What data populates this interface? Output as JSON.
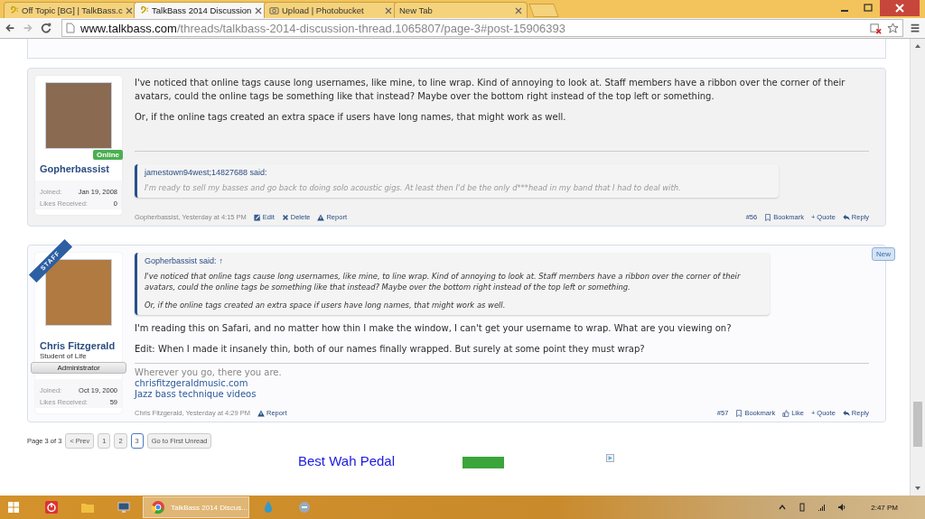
{
  "browser": {
    "tabs": [
      {
        "title": "Off Topic [BG] | TalkBass.c",
        "selected": false,
        "kind": "bass"
      },
      {
        "title": "TalkBass 2014 Discussion",
        "selected": true,
        "kind": "bass"
      },
      {
        "title": "Upload | Photobucket",
        "selected": false,
        "kind": "camera"
      },
      {
        "title": "New Tab",
        "selected": false,
        "kind": "none"
      }
    ],
    "url_host": "www.talkbass.com",
    "url_path": "/threads/talkbass-2014-discussion-thread.1065807/page-3#post-15906393"
  },
  "posts": [
    {
      "author": "Gopherbassist",
      "online": true,
      "online_label": "Online",
      "staff": false,
      "highlighted": true,
      "joined_label": "Joined:",
      "joined": "Jan 19, 2008",
      "likes_label": "Likes Received:",
      "likes": "0",
      "content": [
        {
          "kind": "paragraph",
          "text": "I've noticed that online tags cause long usernames, like mine, to line wrap. Kind of annoying to look at. Staff members have a ribbon over the corner of their avatars, could the online tags be something like that instead? Maybe over the bottom right instead of the top left or something."
        },
        {
          "kind": "paragraph",
          "text": "Or, if the online tags created an extra space if users have long names, that might work as well."
        }
      ],
      "signature": [
        {
          "kind": "quote",
          "author": "jamestown94west;14827688 said:",
          "paragraphs": [
            "I'm ready to sell my basses and go back to doing solo acoustic gigs. At least then I'd be the only d***head in my band that I had to deal with."
          ]
        }
      ],
      "byline": "Gopherbassist, Yesterday at 4:15 PM",
      "left_actions": [
        {
          "kind": "edit",
          "label": "Edit"
        },
        {
          "kind": "delete",
          "label": "Delete"
        },
        {
          "kind": "report",
          "label": "Report"
        }
      ],
      "right_actions": [
        {
          "kind": "permalink",
          "label": "#56"
        },
        {
          "kind": "bookmark",
          "label": "Bookmark"
        },
        {
          "kind": "quote",
          "label": "+ Quote"
        },
        {
          "kind": "reply",
          "label": "Reply"
        }
      ]
    },
    {
      "author": "Chris Fitzgerald",
      "user_title": "Student of Life",
      "role": "Administrator",
      "online": false,
      "staff": true,
      "staff_label": "STAFF",
      "highlighted": false,
      "new_label": "New",
      "joined_label": "Joined:",
      "joined": "Oct 19, 2000",
      "likes_label": "Likes Received:",
      "likes": "59",
      "content": [
        {
          "kind": "quote",
          "author": "Gopherbassist said:",
          "arrow": "↑",
          "paragraphs": [
            "I've noticed that online tags cause long usernames, like mine, to line wrap. Kind of annoying to look at. Staff members have a ribbon over the corner of their avatars, could the online tags be something like that instead? Maybe over the bottom right instead of the top left or something.",
            "Or, if the online tags created an extra space if users have long names, that might work as well."
          ]
        },
        {
          "kind": "paragraph",
          "text": "I'm reading this on Safari, and no matter how thin I make the window, I can't get your username to wrap. What are you viewing on?"
        },
        {
          "kind": "paragraph",
          "text": "Edit: When I made it insanely thin, both of our names finally wrapped. But surely at some point they must wrap?"
        }
      ],
      "signature": [
        {
          "kind": "text",
          "text": "Wherever you go, there you are."
        },
        {
          "kind": "link",
          "text": "chrisfitzgeraldmusic.com"
        },
        {
          "kind": "link",
          "text": "Jazz bass technique videos"
        }
      ],
      "byline": "Chris Fitzgerald, Yesterday at 4:29 PM",
      "left_actions": [
        {
          "kind": "report",
          "label": "Report"
        }
      ],
      "right_actions": [
        {
          "kind": "permalink",
          "label": "#57"
        },
        {
          "kind": "bookmark",
          "label": "Bookmark"
        },
        {
          "kind": "like",
          "label": "Like"
        },
        {
          "kind": "quote",
          "label": "+ Quote"
        },
        {
          "kind": "reply",
          "label": "Reply"
        }
      ]
    }
  ],
  "pagination": {
    "label": "Page 3 of 3",
    "prev": "< Prev",
    "pages": [
      {
        "label": "1",
        "selected": false
      },
      {
        "label": "2",
        "selected": false
      },
      {
        "label": "3",
        "selected": true
      }
    ],
    "first_unread": "Go to First Unread"
  },
  "ad": {
    "text": "Best Wah Pedal"
  },
  "taskbar": {
    "apps": [
      {
        "kind": "power",
        "active": false
      },
      {
        "kind": "folder",
        "active": false
      },
      {
        "kind": "monitor",
        "active": false
      },
      {
        "kind": "chrome",
        "label": "TalkBass 2014 Discus...",
        "active": true
      },
      {
        "kind": "drop",
        "active": false
      },
      {
        "kind": "app",
        "active": false
      }
    ],
    "time": "2:47 PM"
  }
}
